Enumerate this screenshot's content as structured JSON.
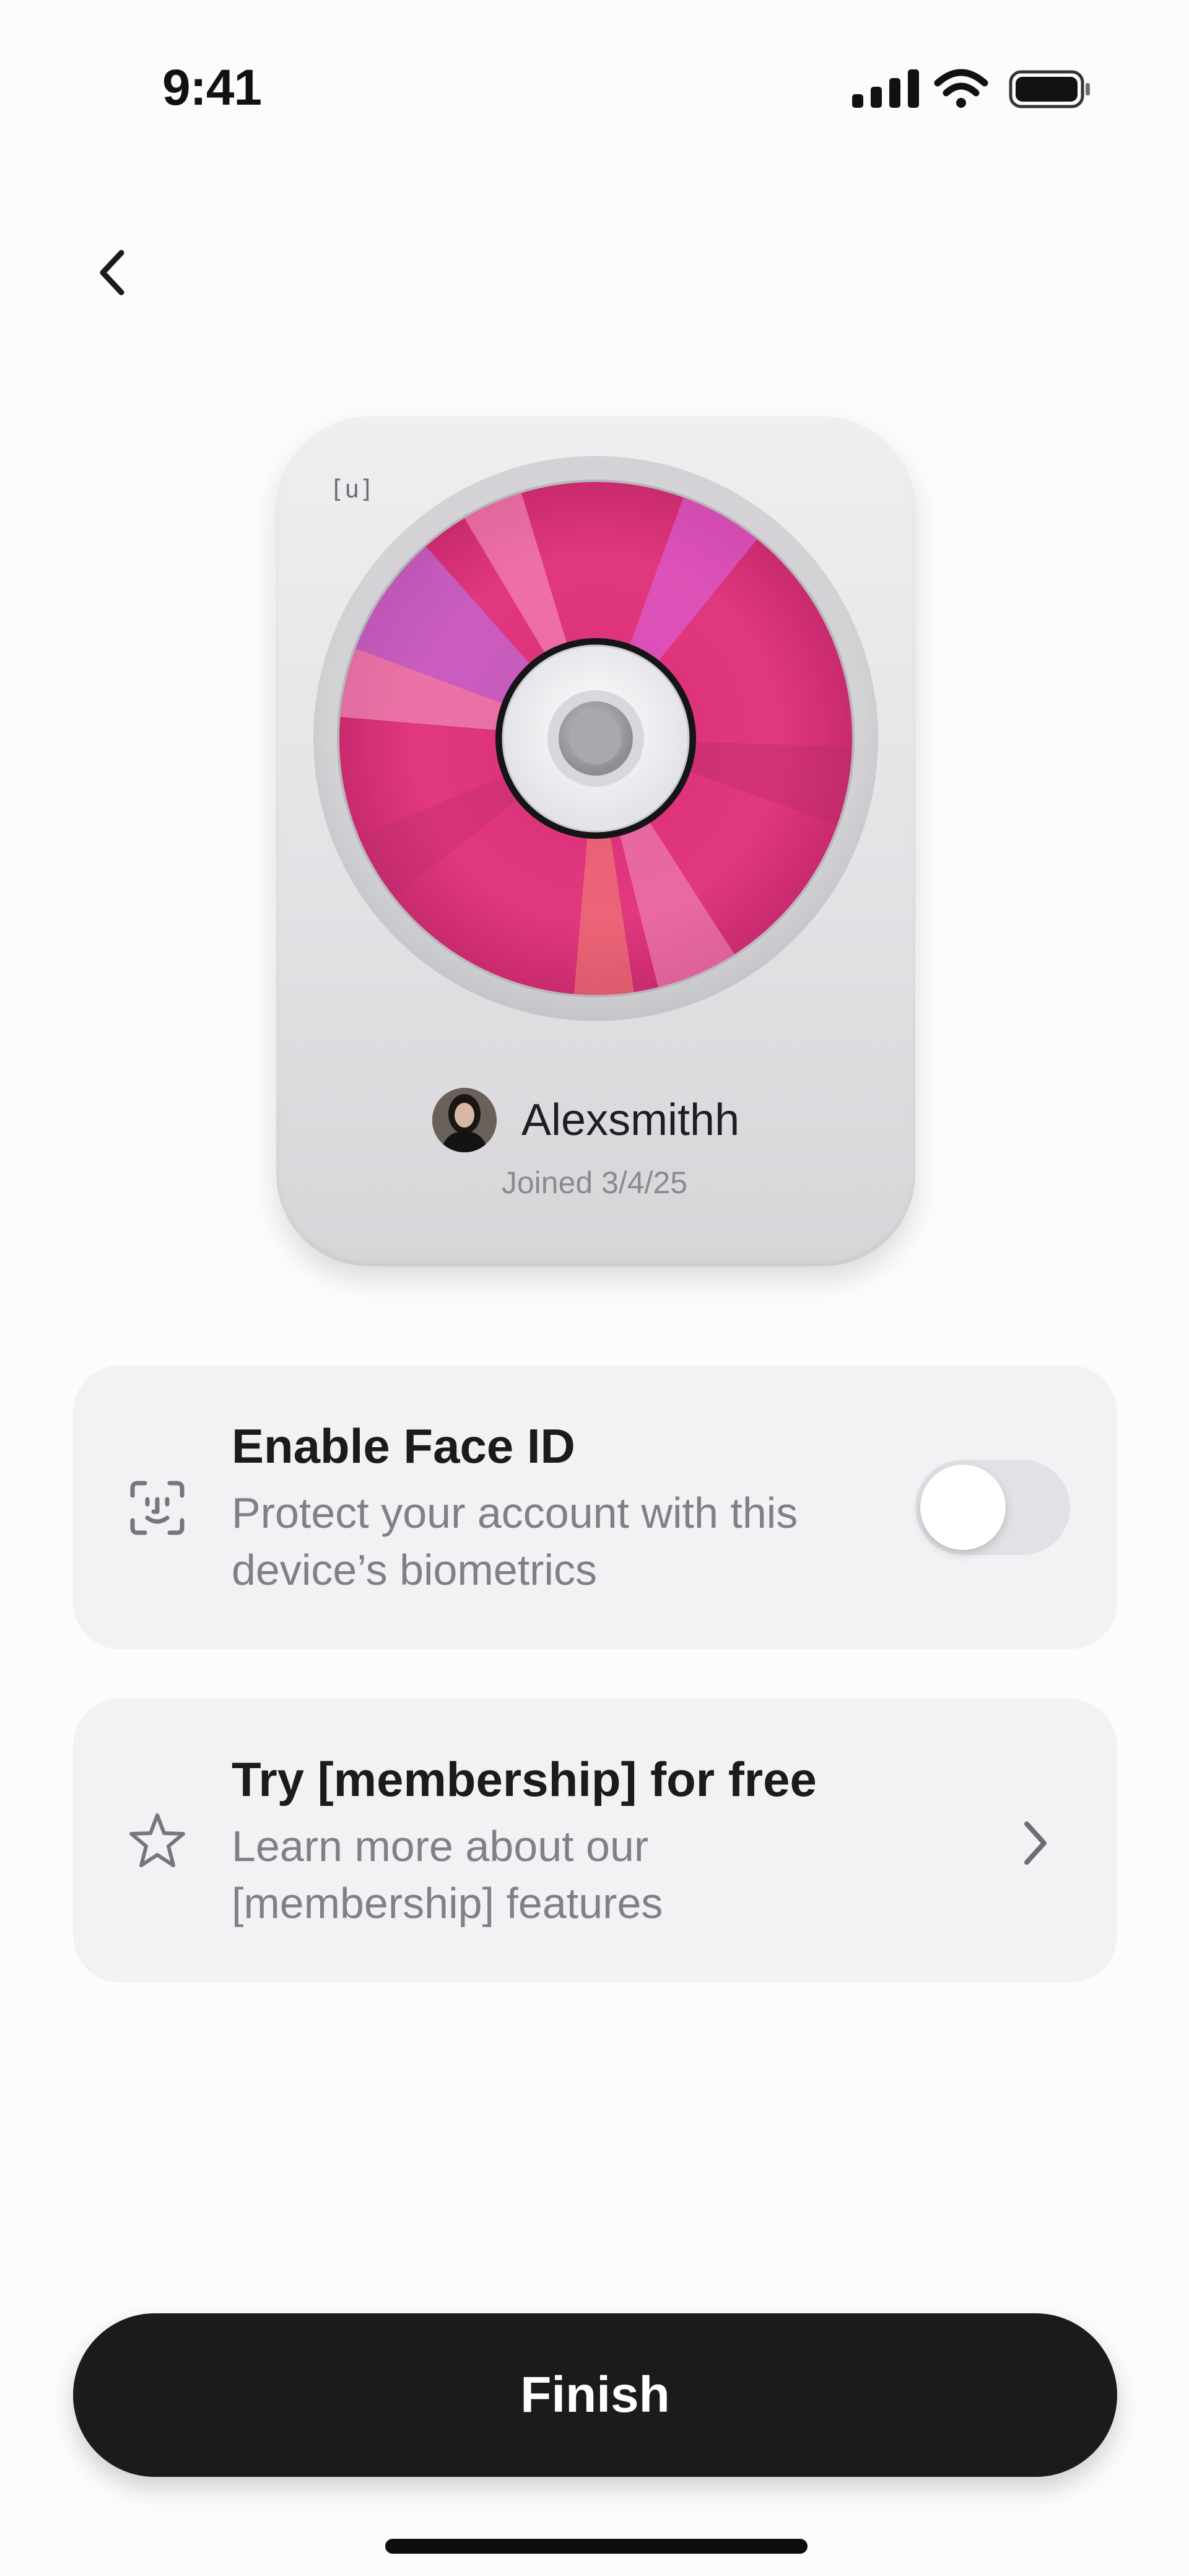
{
  "status_bar": {
    "time": "9:41",
    "icons": [
      "cellular-signal-icon",
      "wifi-icon",
      "battery-icon"
    ]
  },
  "nav": {
    "back_icon": "chevron-left-icon"
  },
  "card": {
    "logo": "[u]",
    "username": "Alexsmithh",
    "joined": "Joined 3/4/25",
    "disc_colors": [
      "#e8327f",
      "#c4338f",
      "#b77cf2",
      "#f29ac1"
    ]
  },
  "options": {
    "face_id": {
      "icon": "face-id-icon",
      "title": "Enable Face ID",
      "description": "Protect your account with this device’s biometrics",
      "enabled": false
    },
    "membership": {
      "icon": "star-outline-icon",
      "title": "Try [membership] for free",
      "description": "Learn more about our [membership] features",
      "trailing_icon": "chevron-right-icon"
    }
  },
  "finish_button": {
    "label": "Finish"
  },
  "colors": {
    "primary_button": "#1b1a1d",
    "option_background": "#f2f1f4",
    "secondary_text": "#808086"
  }
}
